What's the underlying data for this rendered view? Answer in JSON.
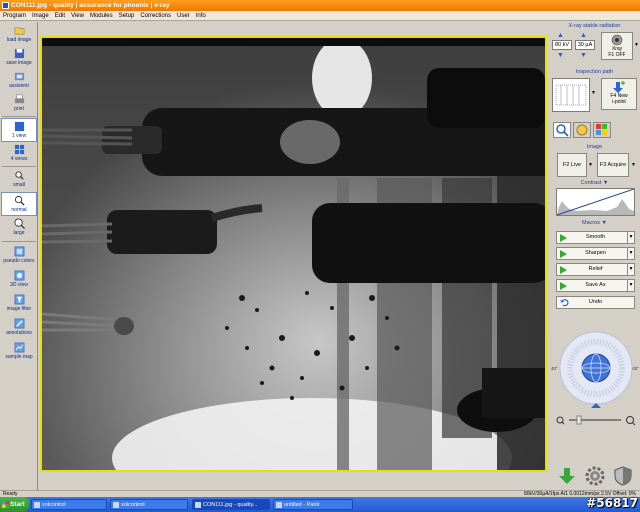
{
  "window": {
    "title": "CON111.jpg - quality | assurance for phoenix | x-ray"
  },
  "menu": [
    "Program",
    "Image",
    "Edit",
    "View",
    "Modules",
    "Setup",
    "Corrections",
    "User",
    "Info"
  ],
  "toolbar": {
    "items": [
      {
        "label": "load image",
        "icon": "folder-icon"
      },
      {
        "label": "save image",
        "icon": "floppy-icon"
      },
      {
        "label": "assistent",
        "icon": "assistant-icon"
      },
      {
        "label": "print",
        "icon": "printer-icon"
      },
      {
        "label": "1 view",
        "icon": "single-view-icon"
      },
      {
        "label": "4 views",
        "icon": "quad-view-icon"
      },
      {
        "label": "small",
        "icon": "zoom-small-icon"
      },
      {
        "label": "normal",
        "icon": "zoom-normal-icon"
      },
      {
        "label": "large",
        "icon": "zoom-large-icon"
      },
      {
        "label": "pseudo colors",
        "icon": "palette-icon"
      },
      {
        "label": "3D view",
        "icon": "cube-icon"
      },
      {
        "label": "image filter",
        "icon": "filter-icon"
      },
      {
        "label": "annotations",
        "icon": "pencil-icon"
      },
      {
        "label": "sample map",
        "icon": "map-icon"
      }
    ]
  },
  "xray": {
    "title": "X-ray stable radiation",
    "voltage": "80 kV",
    "current": "30 µA",
    "button_label": "Xray",
    "button_state": "F1 OFF"
  },
  "inspection": {
    "title": "Inspection path",
    "new_button": "F4 New",
    "new_sub": "i-point"
  },
  "image_section": {
    "title": "Image",
    "live": "F2 Live",
    "acquire": "F3 Acquire"
  },
  "contrast": {
    "title": "Contrast"
  },
  "macros": {
    "title": "Macros",
    "items": [
      "Smooth",
      "Sharpen",
      "Relief",
      "Save As"
    ],
    "undo": "Undo"
  },
  "compass": {
    "left_label": "40°",
    "right_label": "40°"
  },
  "statusbar": {
    "left": "Ready",
    "right": "80kV/30µA/1fps   A/1   0.0012mm/px   2.5V   Offset: 0%"
  },
  "taskbar": {
    "start": "Start",
    "tasks": [
      "xolcontrol",
      "xolcontrol",
      "CON111.jpg - quality...",
      "untitled - Paint"
    ]
  },
  "watermark": "#56817",
  "colors": {
    "accent": "#1f3fa0",
    "frame": "#e8e000",
    "title": "#e97a00"
  }
}
